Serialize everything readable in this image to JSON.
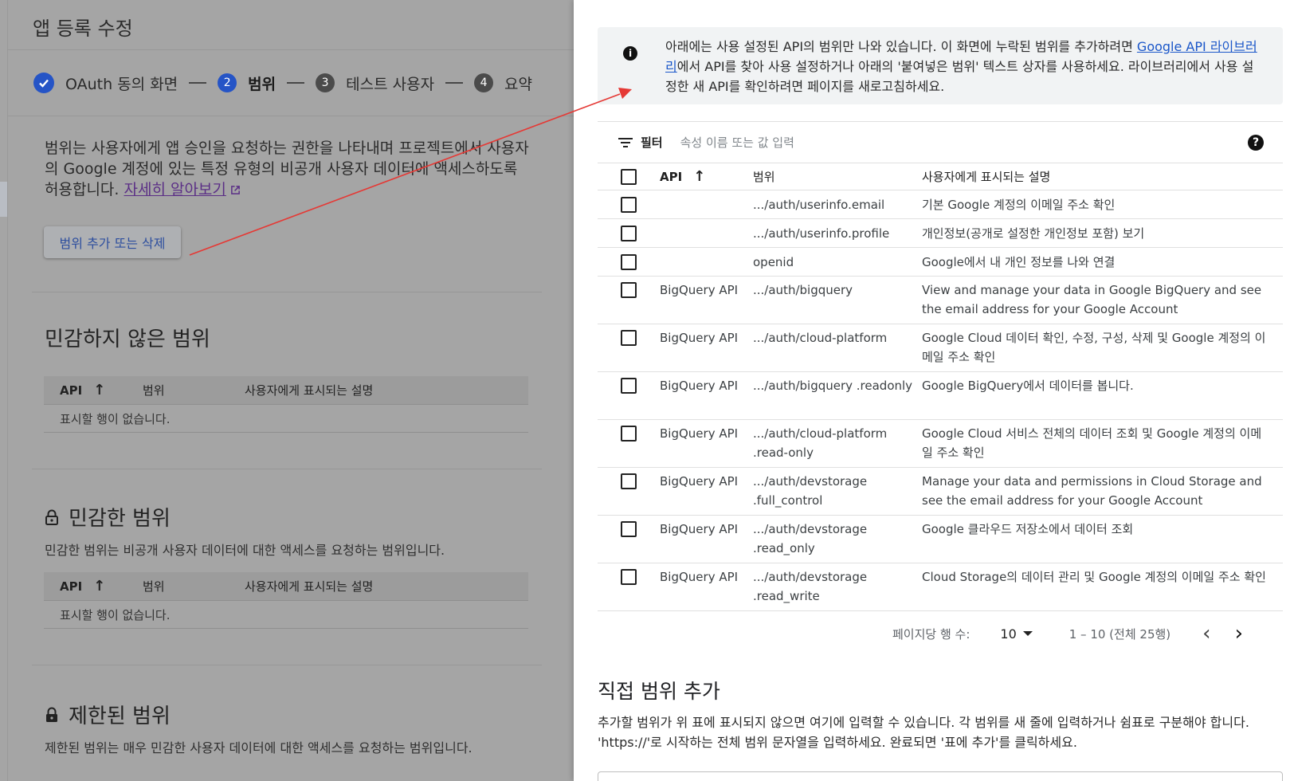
{
  "app": {
    "title": "앱 등록 수정"
  },
  "stepper": {
    "step1_label": "OAuth 동의 화면",
    "step2_num": "2",
    "step2_label": "범위",
    "step3_num": "3",
    "step3_label": "테스트 사용자",
    "step4_num": "4",
    "step4_label": "요약"
  },
  "intro": {
    "text": "범위는 사용자에게 앱 승인을 요청하는 권한을 나타내며 프로젝트에서 사용자의 Google 계정에 있는 특정 유형의 비공개 사용자 데이터에 액세스하도록 허용합니다. ",
    "learn_more": "자세히 알아보기",
    "add_remove_button": "범위 추가 또는 삭제"
  },
  "sections": {
    "nonsensitive": {
      "title": "민감하지 않은 범위",
      "empty": "표시할 행이 없습니다."
    },
    "sensitive": {
      "title": "민감한 범위",
      "subtitle": "민감한 범위는 비공개 사용자 데이터에 대한 액세스를 요청하는 범위입니다.",
      "empty": "표시할 행이 없습니다."
    },
    "restricted": {
      "title": "제한된 범위",
      "subtitle": "제한된 범위는 매우 민감한 사용자 데이터에 대한 액세스를 요청하는 범위입니다."
    }
  },
  "columns": {
    "api": "API",
    "scope": "범위",
    "desc": "사용자에게 표시되는 설명"
  },
  "info": {
    "pre": "아래에는 사용 설정된 API의 범위만 나와 있습니다. 이 화면에 누락된 범위를 추가하려면 ",
    "link": "Google API 라이브러리",
    "post": "에서 API를 찾아 사용 설정하거나 아래의 '붙여넣은 범위' 텍스트 상자를 사용하세요. 라이브러리에서 사용 설정한 새 API를 확인하려면 페이지를 새로고침하세요."
  },
  "filter": {
    "label": "필터",
    "placeholder": "속성 이름 또는 값 입력",
    "help": "?"
  },
  "rows": [
    {
      "api": "",
      "scope": ".../auth/userinfo.email",
      "desc": "기본 Google 계정의 이메일 주소 확인"
    },
    {
      "api": "",
      "scope": ".../auth/userinfo.profile",
      "desc": "개인정보(공개로 설정한 개인정보 포함) 보기"
    },
    {
      "api": "",
      "scope": "openid",
      "desc": "Google에서 내 개인 정보를 나와 연결"
    },
    {
      "api": "BigQuery API",
      "scope": ".../auth/bigquery",
      "desc": "View and manage your data in Google BigQuery and see the email address for your Google Account"
    },
    {
      "api": "BigQuery API",
      "scope": ".../auth/cloud-platform",
      "desc": "Google Cloud 데이터 확인, 수정, 구성, 삭제 및 Google 계정의 이메일 주소 확인"
    },
    {
      "api": "BigQuery API",
      "scope": ".../auth/bigquery .readonly",
      "desc": "Google BigQuery에서 데이터를 봅니다."
    },
    {
      "api": "BigQuery API",
      "scope": ".../auth/cloud-platform .read-only",
      "desc": "Google Cloud 서비스 전체의 데이터 조회 및 Google 계정의 이메일 주소 확인"
    },
    {
      "api": "BigQuery API",
      "scope": ".../auth/devstorage .full_control",
      "desc": "Manage your data and permissions in Cloud Storage and see the email address for your Google Account"
    },
    {
      "api": "BigQuery API",
      "scope": ".../auth/devstorage .read_only",
      "desc": "Google 클라우드 저장소에서 데이터 조회"
    },
    {
      "api": "BigQuery API",
      "scope": ".../auth/devstorage .read_write",
      "desc": "Cloud Storage의 데이터 관리 및 Google 계정의 이메일 주소 확인"
    }
  ],
  "pager": {
    "label": "페이지당 행 수:",
    "rows_per_page": "10",
    "range": "1 – 10 (전체 25행)",
    "prev": "‹",
    "next": "›"
  },
  "manual": {
    "title": "직접 범위 추가",
    "desc": "추가할 범위가 위 표에 표시되지 않으면 여기에 입력할 수 있습니다. 각 범위를 새 줄에 입력하거나 쉼표로 구분해야 합니다. 'https://'로 시작하는 전체 범위 문자열을 입력하세요. 완료되면 '표에 추가'를 클릭하세요."
  },
  "icons": {
    "step1": "check-circle-icon",
    "info": "info-icon",
    "filter": "filter-icon",
    "sort": "arrow-up-icon",
    "lock": "lock-icon",
    "external": "open-in-new-icon"
  },
  "colors": {
    "accent": "#2554c6",
    "link": "#1a56c9",
    "annotation_arrow": "#e53935"
  }
}
